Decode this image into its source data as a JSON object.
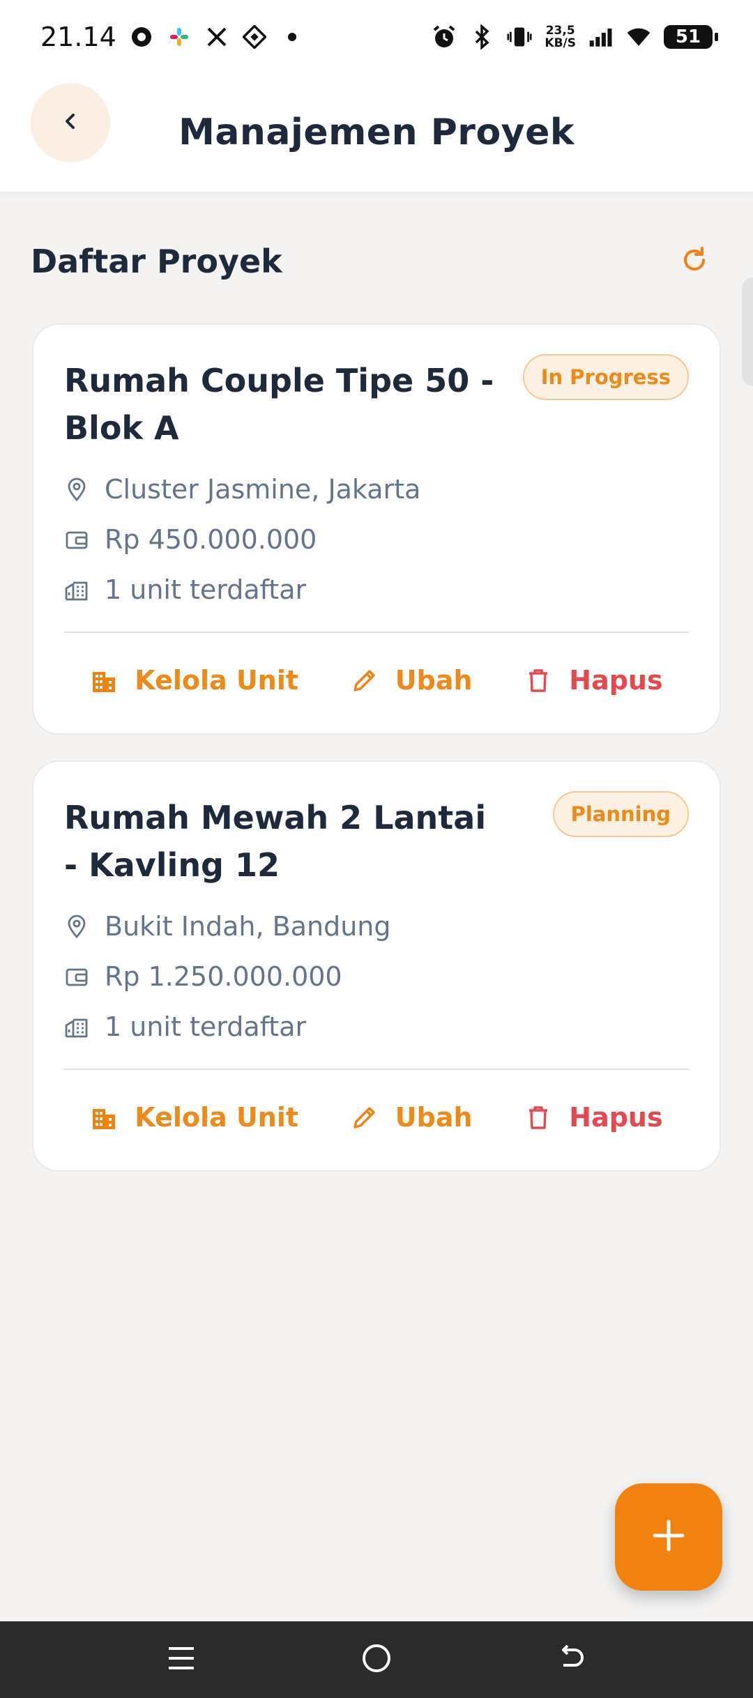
{
  "status_bar": {
    "time": "21.14",
    "network_speed_value": "23,5",
    "network_speed_unit": "KB/S",
    "battery": "51",
    "left_icons": [
      "record-icon",
      "slack-icon",
      "x-icon",
      "app-icon",
      "dot-icon"
    ],
    "right_icons": [
      "alarm-icon",
      "bluetooth-icon",
      "vibrate-icon",
      "signal-icon",
      "wifi-icon",
      "battery-icon"
    ]
  },
  "app_bar": {
    "title": "Manajemen Proyek",
    "back_icon": "chevron-left-icon"
  },
  "section": {
    "title": "Daftar Proyek",
    "refresh_icon": "refresh-icon"
  },
  "projects": [
    {
      "title": "Rumah Couple Tipe 50 - Blok A",
      "status": "In Progress",
      "location": "Cluster Jasmine, Jakarta",
      "budget": "Rp 450.000.000",
      "units": "1 unit terdaftar",
      "actions": {
        "manage": "Kelola Unit",
        "edit": "Ubah",
        "delete": "Hapus"
      }
    },
    {
      "title": "Rumah Mewah 2 Lantai - Kavling 12",
      "status": "Planning",
      "location": "Bukit Indah, Bandung",
      "budget": "Rp 1.250.000.000",
      "units": "1 unit terdaftar",
      "actions": {
        "manage": "Kelola Unit",
        "edit": "Ubah",
        "delete": "Hapus"
      }
    }
  ],
  "fab": {
    "icon": "plus-icon"
  },
  "nav_bar": {
    "icons": [
      "menu-icon",
      "home-icon",
      "back-icon"
    ]
  },
  "colors": {
    "accent": "#F2820F",
    "accent_text": "#EE8A18",
    "danger": "#E5484D",
    "title_text": "#1E293B",
    "muted_text": "#64748B",
    "background": "#F4F3F2"
  }
}
